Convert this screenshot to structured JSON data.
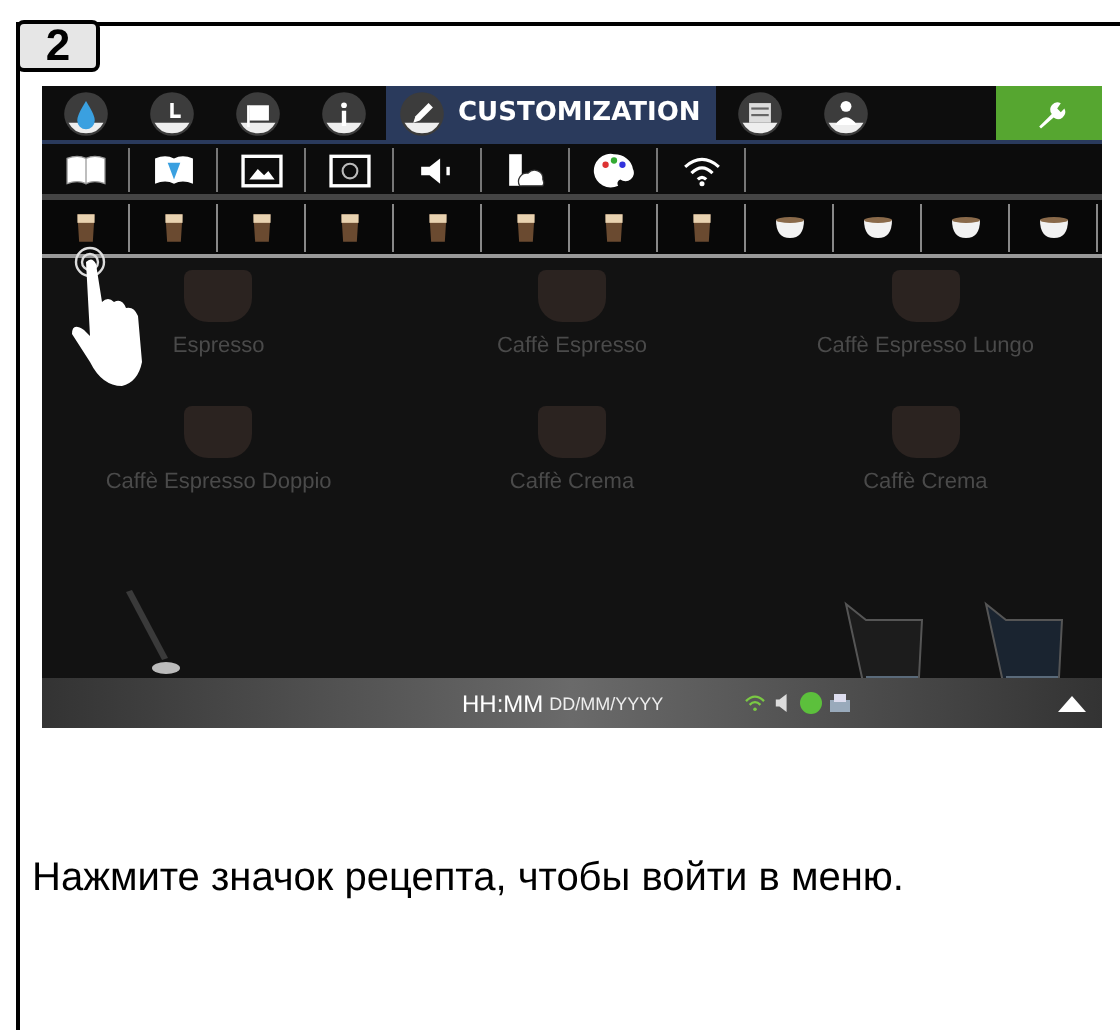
{
  "step": {
    "number": "2"
  },
  "screen": {
    "nav_tabs": [
      {
        "kind": "drop",
        "selected": false
      },
      {
        "kind": "clock",
        "selected": false
      },
      {
        "kind": "flag",
        "selected": false
      },
      {
        "kind": "info",
        "selected": false
      },
      {
        "kind": "pencil",
        "label": "CUSTOMIZATION",
        "selected": true
      },
      {
        "kind": "monitor",
        "selected": false
      },
      {
        "kind": "person",
        "selected": false
      },
      {
        "kind": "wrench",
        "selected": false
      }
    ],
    "tool_icons": [
      {
        "kind": "book"
      },
      {
        "kind": "book-open"
      },
      {
        "kind": "image"
      },
      {
        "kind": "frame"
      },
      {
        "kind": "speaker"
      },
      {
        "kind": "usb"
      },
      {
        "kind": "palette"
      },
      {
        "kind": "wifi"
      }
    ],
    "drink_icons": [
      {
        "kind": "glass"
      },
      {
        "kind": "glass"
      },
      {
        "kind": "glass"
      },
      {
        "kind": "glass"
      },
      {
        "kind": "glass"
      },
      {
        "kind": "glass"
      },
      {
        "kind": "glass"
      },
      {
        "kind": "glass"
      },
      {
        "kind": "cup"
      },
      {
        "kind": "cup"
      },
      {
        "kind": "cup"
      },
      {
        "kind": "cup"
      }
    ],
    "recipes": [
      {
        "name": "Espresso"
      },
      {
        "name": "Caffè Espresso"
      },
      {
        "name": "Caffè Espresso Lungo"
      },
      {
        "name": "Caffè Espresso Doppio"
      },
      {
        "name": "Caffè Crema"
      },
      {
        "name": "Caffè Crema"
      }
    ],
    "status_bar": {
      "time": "HH:MM",
      "date": "DD/MM/YYYY"
    }
  },
  "instruction": "Нажмите значок рецепта, чтобы войти в меню."
}
